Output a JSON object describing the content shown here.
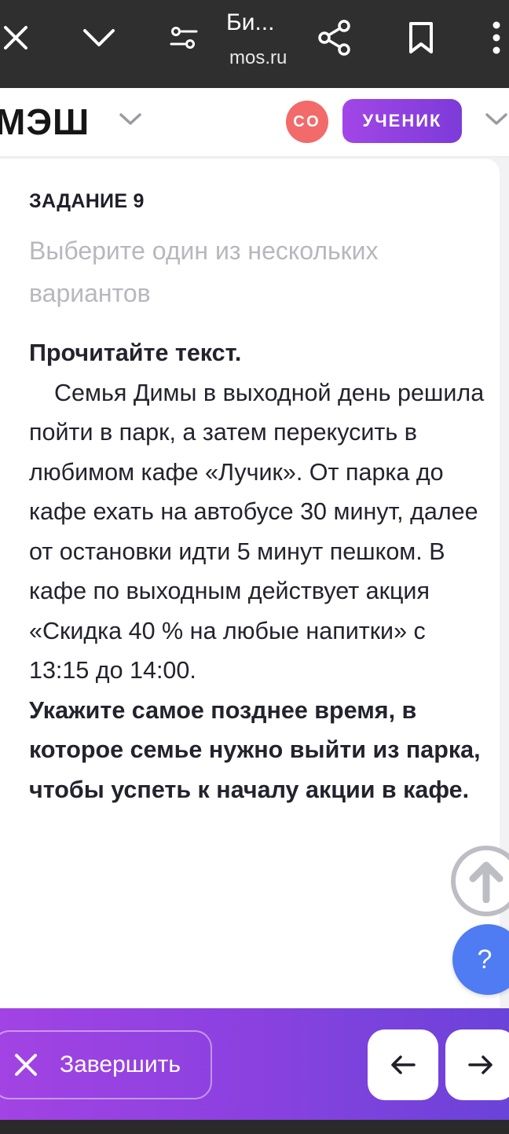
{
  "browser": {
    "title": "Би...",
    "url": "mos.ru",
    "icons": [
      "close-icon",
      "chevron-down-icon",
      "tune-icon",
      "share-icon",
      "bookmark-icon",
      "more-icon"
    ]
  },
  "header": {
    "logo": "МЭШ",
    "avatar_initials": "СО",
    "role_label": "УЧЕНИК"
  },
  "task": {
    "label": "ЗАДАНИЕ 9",
    "hint": "Выберите один из нескольких вариантов",
    "intro": "Прочитайте текст.",
    "body": "Семья Димы в выходной день решила пойти в парк, а затем перекусить в любимом кафе «Лучик». От парка до кафе ехать на автобусе 30 минут, далее от остановки идти 5 минут пешком. В кафе по выходным действует акция «Скидка 40 % на любые напитки» с 13:15 до 14:00.",
    "question": "Укажите самое позднее время, в которое семье нужно выйти из парка, чтобы успеть к началу акции в кафе."
  },
  "floating": {
    "help_label": "?"
  },
  "footer": {
    "finish_label": "Завершить"
  },
  "colors": {
    "accent_purple": "#8a41df",
    "avatar_red": "#f26a6a",
    "help_blue": "#4f7bf3"
  }
}
